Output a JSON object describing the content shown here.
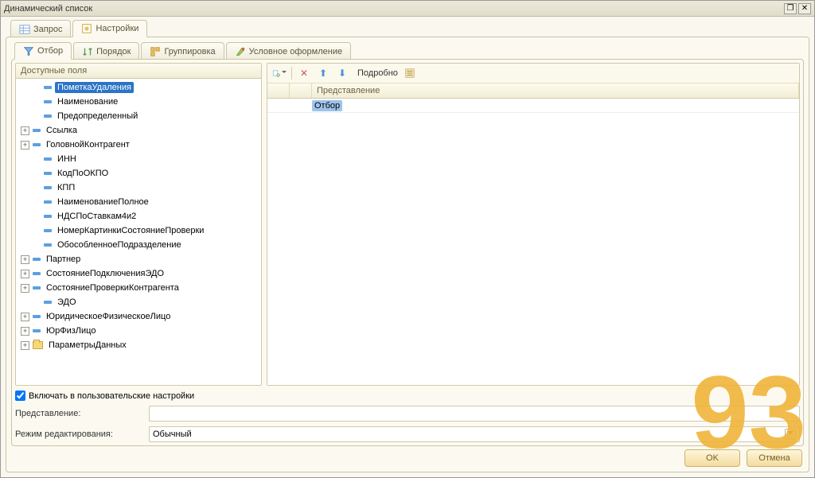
{
  "title": "Динамический список",
  "main_tabs": {
    "query": "Запрос",
    "settings": "Настройки"
  },
  "sub_tabs": {
    "filter": "Отбор",
    "order": "Порядок",
    "group": "Группировка",
    "cond": "Условное оформление"
  },
  "left": {
    "header": "Доступные поля",
    "items": [
      {
        "exp": "",
        "icon": "minus",
        "label": "ПометкаУдаления",
        "selected": true,
        "indent": 1
      },
      {
        "exp": "",
        "icon": "minus",
        "label": "Наименование",
        "indent": 1
      },
      {
        "exp": "",
        "icon": "minus",
        "label": "Предопределенный",
        "indent": 1
      },
      {
        "exp": "+",
        "icon": "minus",
        "label": "Ссылка",
        "indent": 0
      },
      {
        "exp": "+",
        "icon": "minus",
        "label": "ГоловнойКонтрагент",
        "indent": 0
      },
      {
        "exp": "",
        "icon": "minus",
        "label": "ИНН",
        "indent": 1
      },
      {
        "exp": "",
        "icon": "minus",
        "label": "КодПоОКПО",
        "indent": 1
      },
      {
        "exp": "",
        "icon": "minus",
        "label": "КПП",
        "indent": 1
      },
      {
        "exp": "",
        "icon": "minus",
        "label": "НаименованиеПолное",
        "indent": 1
      },
      {
        "exp": "",
        "icon": "minus",
        "label": "НДСПоСтавкам4и2",
        "indent": 1
      },
      {
        "exp": "",
        "icon": "minus",
        "label": "НомерКартинкиСостояниеПроверки",
        "indent": 1
      },
      {
        "exp": "",
        "icon": "minus",
        "label": "ОбособленноеПодразделение",
        "indent": 1
      },
      {
        "exp": "+",
        "icon": "minus",
        "label": "Партнер",
        "indent": 0
      },
      {
        "exp": "+",
        "icon": "minus",
        "label": "СостояниеПодключенияЭДО",
        "indent": 0
      },
      {
        "exp": "+",
        "icon": "minus",
        "label": "СостояниеПроверкиКонтрагента",
        "indent": 0
      },
      {
        "exp": "",
        "icon": "minus",
        "label": "ЭДО",
        "indent": 1
      },
      {
        "exp": "+",
        "icon": "minus",
        "label": "ЮридическоеФизическоеЛицо",
        "indent": 0
      },
      {
        "exp": "+",
        "icon": "minus",
        "label": "ЮрФизЛицо",
        "indent": 0
      },
      {
        "exp": "+",
        "icon": "folder",
        "label": "ПараметрыДанных",
        "indent": 0
      }
    ]
  },
  "right": {
    "toolbar": {
      "details": "Подробно"
    },
    "header": "Представление",
    "rows": [
      {
        "label": "Отбор",
        "selected": true
      }
    ]
  },
  "lower": {
    "include_user": "Включать в пользовательские настройки",
    "presentation_label": "Представление:",
    "presentation_value": "",
    "mode_label": "Режим редактирования:",
    "mode_value": "Обычный"
  },
  "buttons": {
    "ok": "OK",
    "cancel": "Отмена"
  }
}
